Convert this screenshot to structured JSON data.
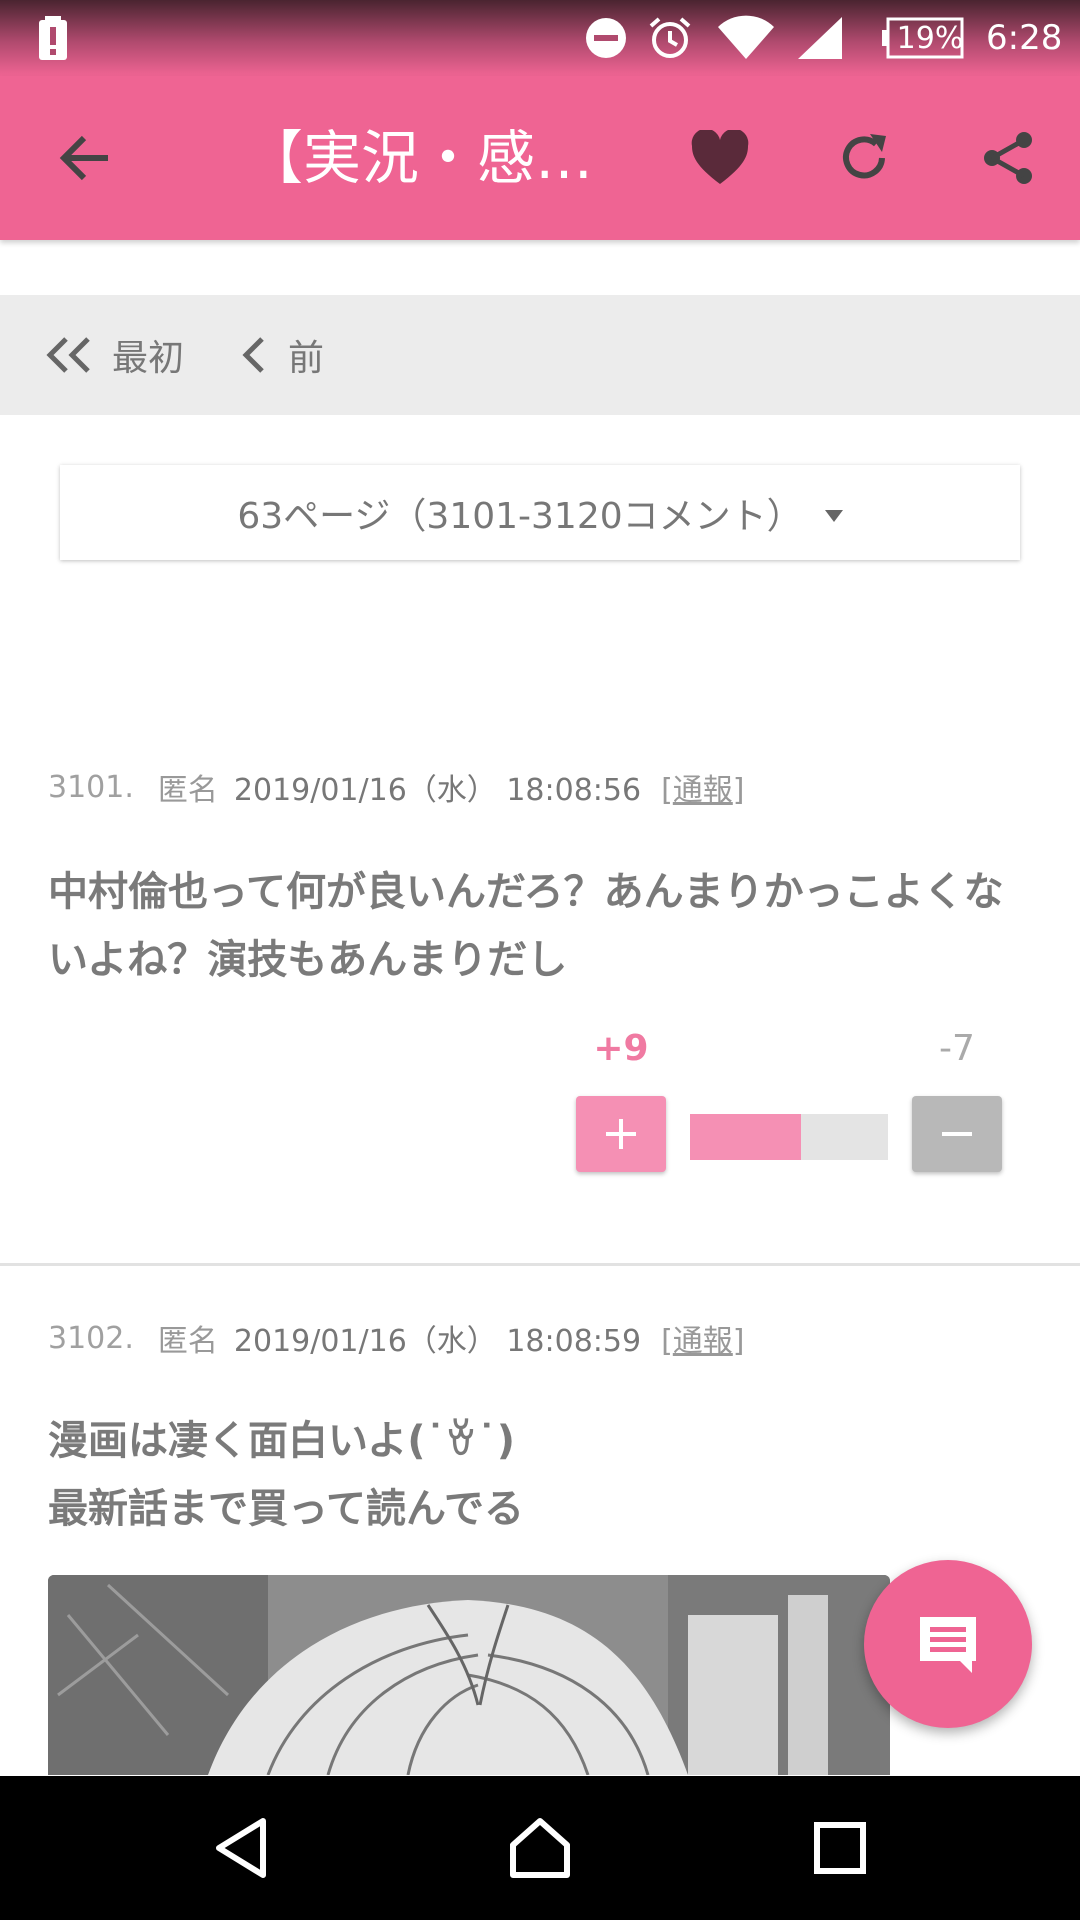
{
  "status_bar": {
    "battery_percent": "19%",
    "time": "6:28",
    "icons": [
      "battery-alert-icon",
      "do-not-disturb-icon",
      "alarm-icon",
      "wifi-icon",
      "cell-signal-icon",
      "battery-icon"
    ]
  },
  "app_bar": {
    "title": "【実況・感想...",
    "icons": [
      "back-arrow-icon",
      "heart-icon",
      "refresh-icon",
      "share-icon"
    ],
    "color": "#ef6493"
  },
  "nav": {
    "first_label": "最初",
    "prev_label": "前"
  },
  "page_selector": {
    "label": "63ページ（3101-3120コメント）"
  },
  "comments": [
    {
      "number": "3101.",
      "author": "匿名",
      "date": "2019/01/16（水） 18:08:56",
      "report_open": "[",
      "report_label": "通報",
      "report_close": "]",
      "body": "中村倫也って何が良いんだろ？あんまりかっこよくないよね？演技もあんまりだし",
      "plus_count": "+9",
      "minus_count": "-7",
      "plus_ratio": 0.5625
    },
    {
      "number": "3102.",
      "author": "匿名",
      "date": "2019/01/16（水） 18:08:59",
      "report_open": "[",
      "report_label": "通報",
      "report_close": "]",
      "body_line1": "漫画は凄く面白いよ(˙ꈊ˙)",
      "body_line2": "最新話まで買って読んでる"
    }
  ],
  "colors": {
    "accent": "#ef6493",
    "plus": "#f590b4",
    "minus": "#b8b8b8",
    "nav_strip": "#ececec"
  }
}
